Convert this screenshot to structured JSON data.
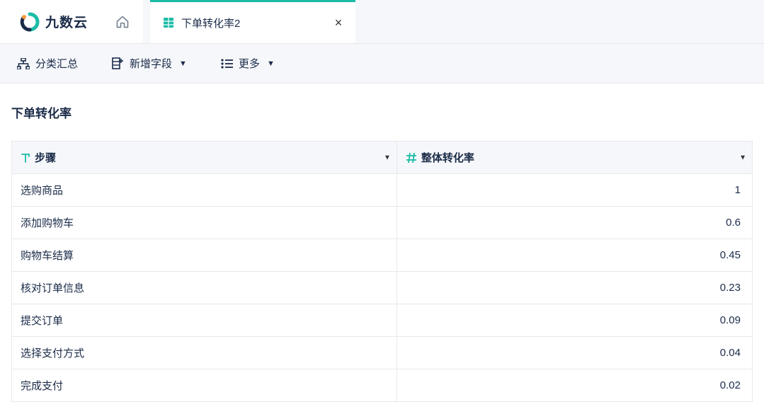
{
  "brand": "九数云",
  "tab": {
    "label": "下单转化率2"
  },
  "toolbar": {
    "classify_summary": "分类汇总",
    "add_field": "新增字段",
    "more": "更多"
  },
  "page": {
    "title": "下单转化率"
  },
  "table": {
    "columns": {
      "step": "步骤",
      "conversion_rate": "整体转化率"
    },
    "rows": [
      {
        "step": "选购商品",
        "rate": "1"
      },
      {
        "step": "添加购物车",
        "rate": "0.6"
      },
      {
        "step": "购物车结算",
        "rate": "0.45"
      },
      {
        "step": "核对订单信息",
        "rate": "0.23"
      },
      {
        "step": "提交订单",
        "rate": "0.09"
      },
      {
        "step": "选择支付方式",
        "rate": "0.04"
      },
      {
        "step": "完成支付",
        "rate": "0.02"
      }
    ]
  },
  "colors": {
    "accent": "#1bbba6",
    "text_primary": "#1a2b48",
    "bg_header": "#f5f7fa",
    "border": "#e8e8e8"
  }
}
